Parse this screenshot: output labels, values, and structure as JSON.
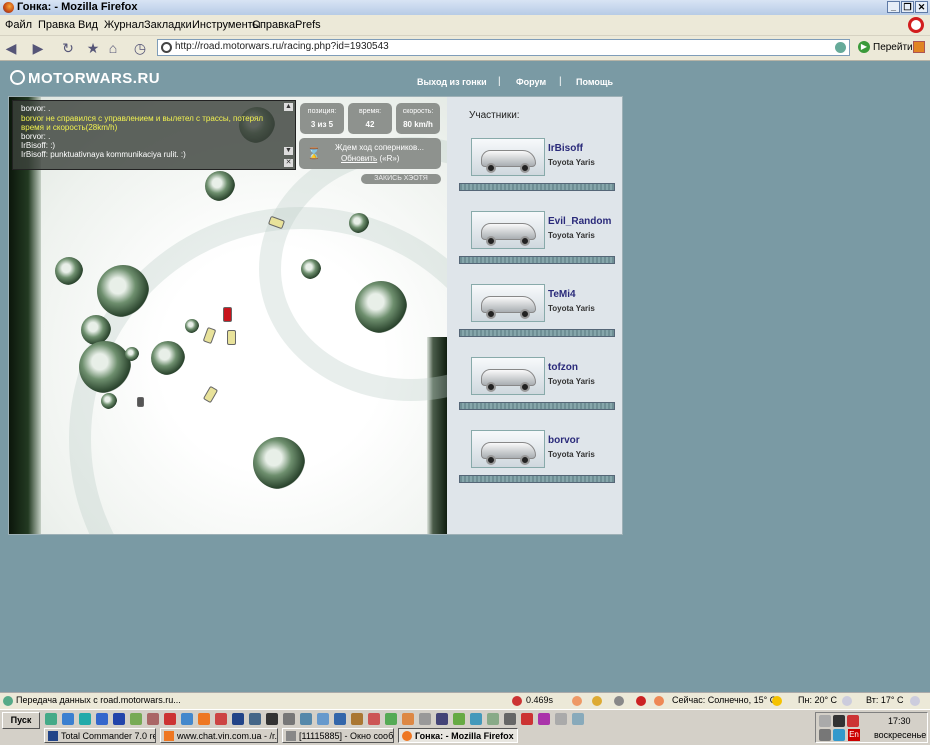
{
  "window": {
    "title": "Гонка: - Mozilla Firefox",
    "minimize_icon": "minimize-icon",
    "maximize_icon": "restore-icon",
    "close_icon": "close-icon"
  },
  "menu": [
    "Файл",
    "Правка",
    "Вид",
    "Журнал",
    "Закладки",
    "Инструменты",
    "Справка",
    "Prefs"
  ],
  "navbar": {
    "url": "http://road.motorwars.ru/racing.php?id=1930543",
    "go_label": "Перейти"
  },
  "site": {
    "logo_text": "MOTORWARS.RU",
    "nav": [
      "Выход из гонки",
      "Форум",
      "Помощь"
    ]
  },
  "chat": {
    "lines": [
      {
        "text": "borvor: .",
        "highlight": false
      },
      {
        "text": "borvor не справился с управлением и вылетел с трассы, потерял",
        "highlight": true
      },
      {
        "text": "время и скорость(28km/h)",
        "highlight": true
      },
      {
        "text": "borvor: .",
        "highlight": false
      },
      {
        "text": "IrBisoff: :)",
        "highlight": false
      },
      {
        "text": "IrBisoff: punktuativnaya kommunikaciya rulit. :)",
        "highlight": false
      }
    ]
  },
  "stats": {
    "position_label": "позиция:",
    "position_value": "3 из 5",
    "time_label": "время:",
    "time_value": "42",
    "speed_label": "скорость:",
    "speed_value": "80 km/h"
  },
  "wait": {
    "line1": "Ждем ход соперников...",
    "refresh_link": "Обновить",
    "refresh_hint": "(«R»)",
    "take_back": "ЗАКИСЬ ХЭОТЯ"
  },
  "participants": {
    "title": "Участники:",
    "list": [
      {
        "name": "IrBisoff",
        "car": "Toyota Yaris"
      },
      {
        "name": "Evil_Random",
        "car": "Toyota Yaris"
      },
      {
        "name": "TeMi4",
        "car": "Toyota Yaris"
      },
      {
        "name": "tofzon",
        "car": "Toyota Yaris"
      },
      {
        "name": "borvor",
        "car": "Toyota Yaris"
      }
    ]
  },
  "status": {
    "message": "Передача данных с road.motorwars.ru...",
    "timing": "0.469s",
    "weather_today": "Сейчас: Солнечно, 15° C",
    "weather_mon": "Пн: 20° C",
    "weather_tue": "Вт: 17° C"
  },
  "taskbar": {
    "start": "Пуск",
    "tasks": [
      "Total Commander 7.0 rele...",
      "www.chat.vin.com.ua - /r...",
      "[11115885] - Окно сооб...",
      "Гонка: - Mozilla Firefox"
    ],
    "lang": "En",
    "clock": "17:30",
    "day": "воскресенье"
  },
  "colors": {
    "page_bg": "#7a9aa4",
    "participant_name": "#2a2a7a",
    "chat_warning": "#f2f250"
  }
}
